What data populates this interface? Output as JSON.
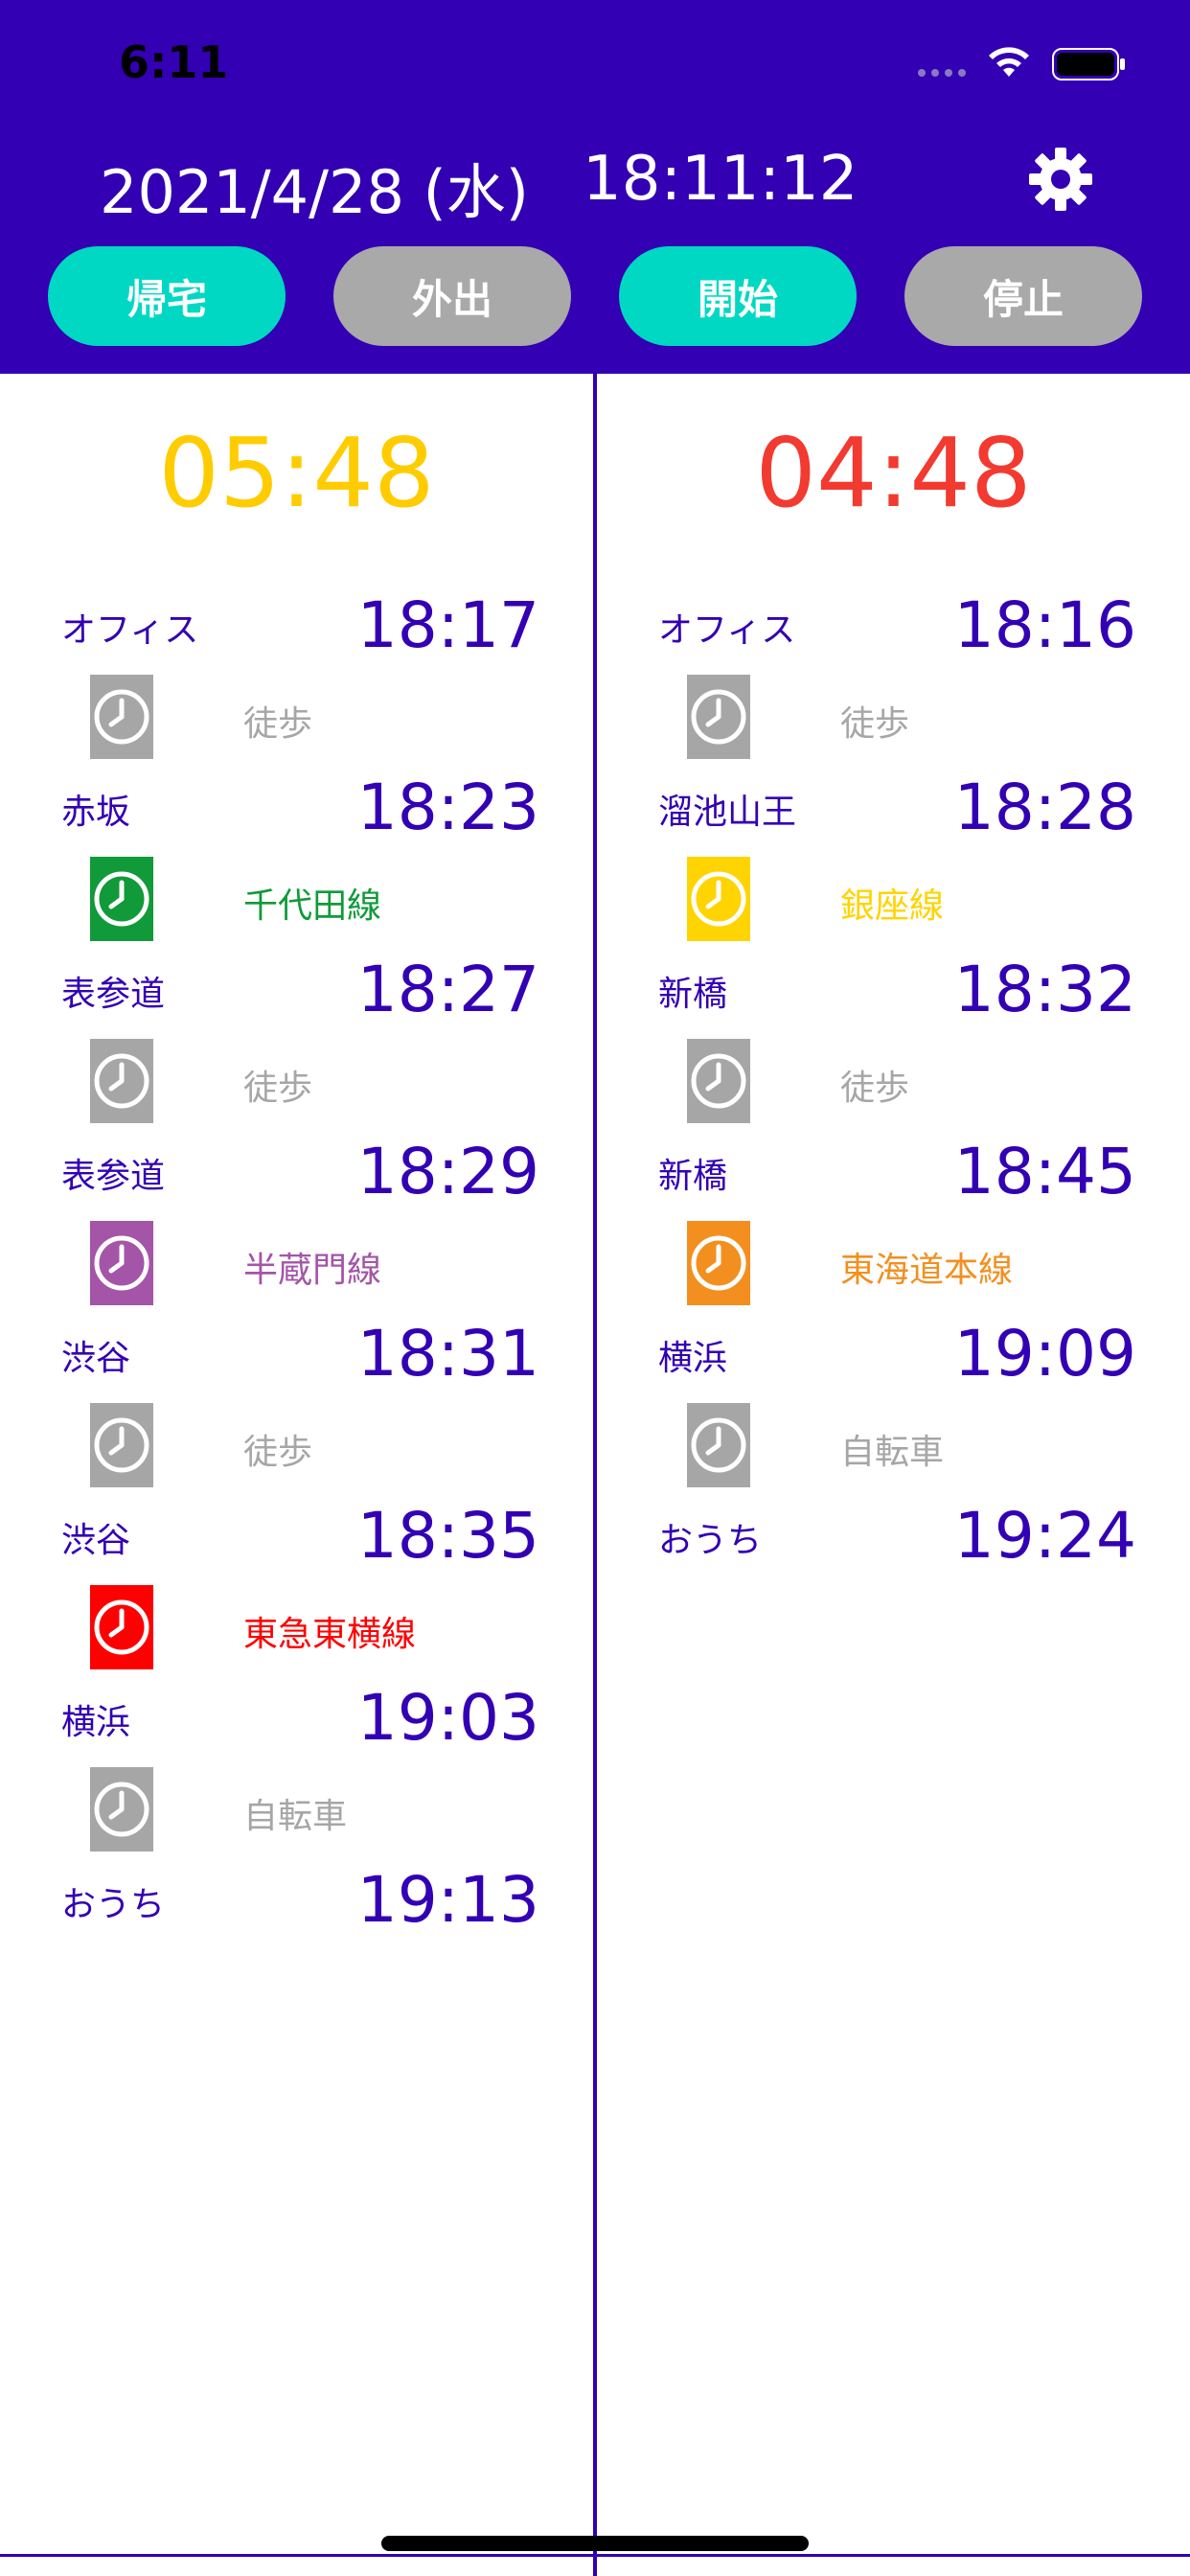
{
  "status_bar": {
    "time": "6:11"
  },
  "header": {
    "date": "2021/4/28 (水)",
    "clock": "18:11:12",
    "buttons": [
      {
        "label": "帰宅",
        "style": "teal"
      },
      {
        "label": "外出",
        "style": "gray"
      },
      {
        "label": "開始",
        "style": "teal"
      },
      {
        "label": "停止",
        "style": "gray"
      }
    ],
    "settings_icon": "gear-icon"
  },
  "colors": {
    "header_bg": "#3300B4",
    "teal": "#00D8C4",
    "gray": "#A9A9A9",
    "text": "#3300B4",
    "walk": "#A6A6A6",
    "chiyoda": "#119A3A",
    "hanzomon": "#A455A8",
    "toyoko": "#FF0000",
    "ginza": "#FFD400",
    "tokaido": "#F38F1F",
    "countdown_left": "#FFCC00",
    "countdown_right": "#F23A30"
  },
  "routes": [
    {
      "countdown": "05:48",
      "countdown_color": "#FFCC00",
      "stops": [
        {
          "station": "オフィス",
          "time": "18:17"
        },
        {
          "station": "赤坂",
          "time": "18:23"
        },
        {
          "station": "表参道",
          "time": "18:27"
        },
        {
          "station": "表参道",
          "time": "18:29"
        },
        {
          "station": "渋谷",
          "time": "18:31"
        },
        {
          "station": "渋谷",
          "time": "18:35"
        },
        {
          "station": "横浜",
          "time": "19:03"
        },
        {
          "station": "おうち",
          "time": "19:13"
        }
      ],
      "segments": [
        {
          "label": "徒歩",
          "color": "#A6A6A6",
          "icon": "clock-icon"
        },
        {
          "label": "千代田線",
          "color": "#119A3A",
          "icon": "clock-icon"
        },
        {
          "label": "徒歩",
          "color": "#A6A6A6",
          "icon": "clock-icon"
        },
        {
          "label": "半蔵門線",
          "color": "#A455A8",
          "icon": "clock-icon"
        },
        {
          "label": "徒歩",
          "color": "#A6A6A6",
          "icon": "clock-icon"
        },
        {
          "label": "東急東横線",
          "color": "#FF0000",
          "icon": "clock-icon"
        },
        {
          "label": "自転車",
          "color": "#A6A6A6",
          "icon": "clock-icon"
        }
      ]
    },
    {
      "countdown": "04:48",
      "countdown_color": "#F23A30",
      "stops": [
        {
          "station": "オフィス",
          "time": "18:16"
        },
        {
          "station": "溜池山王",
          "time": "18:28"
        },
        {
          "station": "新橋",
          "time": "18:32"
        },
        {
          "station": "新橋",
          "time": "18:45"
        },
        {
          "station": "横浜",
          "time": "19:09"
        },
        {
          "station": "おうち",
          "time": "19:24"
        }
      ],
      "segments": [
        {
          "label": "徒歩",
          "color": "#A6A6A6",
          "icon": "clock-icon"
        },
        {
          "label": "銀座線",
          "color": "#FFD400",
          "icon": "clock-icon"
        },
        {
          "label": "徒歩",
          "color": "#A6A6A6",
          "icon": "clock-icon"
        },
        {
          "label": "東海道本線",
          "color": "#F38F1F",
          "icon": "clock-icon"
        },
        {
          "label": "自転車",
          "color": "#A6A6A6",
          "icon": "clock-icon"
        }
      ]
    }
  ]
}
